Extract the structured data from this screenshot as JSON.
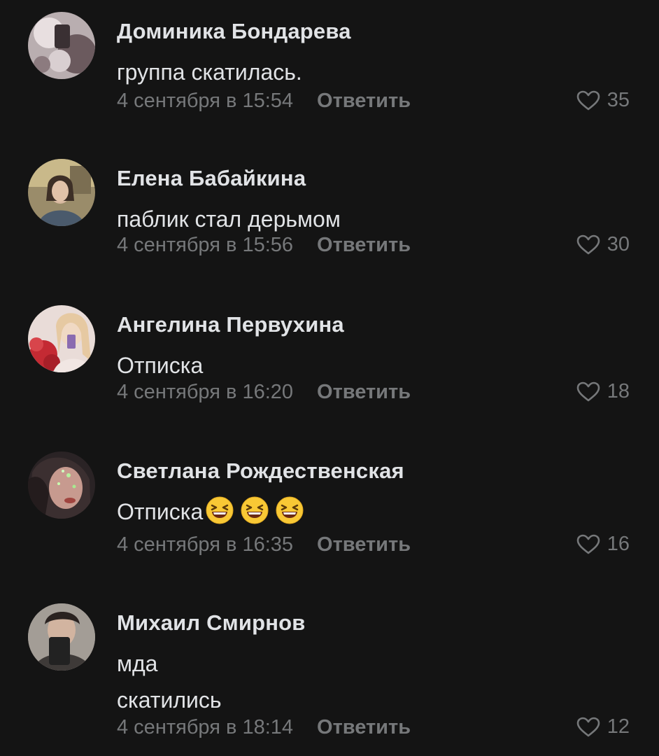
{
  "colors": {
    "background": "#141414",
    "text": "#e1e3e6",
    "secondary": "#76787a"
  },
  "comments": [
    {
      "author": "Доминика Бондарева",
      "lines": [
        "группа скатилась."
      ],
      "date": "4 сентября в 15:54",
      "reply_label": "Ответить",
      "likes": "35",
      "avatar_icon": "user-photo"
    },
    {
      "author": "Елена Бабайкина",
      "lines": [
        "паблик стал дерьмом"
      ],
      "date": "4 сентября в 15:56",
      "reply_label": "Ответить",
      "likes": "30",
      "avatar_icon": "user-photo"
    },
    {
      "author": "Ангелина Первухина",
      "lines": [
        "Отписка"
      ],
      "date": "4 сентября в 16:20",
      "reply_label": "Ответить",
      "likes": "18",
      "avatar_icon": "user-photo"
    },
    {
      "author": "Светлана Рождественская",
      "lines": [
        "Отписка"
      ],
      "emoji": [
        "laughing-squint-emoji",
        "laughing-squint-emoji",
        "laughing-squint-emoji"
      ],
      "date": "4 сентября в 16:35",
      "reply_label": "Ответить",
      "likes": "16",
      "avatar_icon": "user-photo"
    },
    {
      "author": "Михаил Смирнов",
      "lines": [
        "мда",
        "скатились"
      ],
      "date": "4 сентября в 18:14",
      "reply_label": "Ответить",
      "likes": "12",
      "avatar_icon": "user-photo"
    }
  ]
}
